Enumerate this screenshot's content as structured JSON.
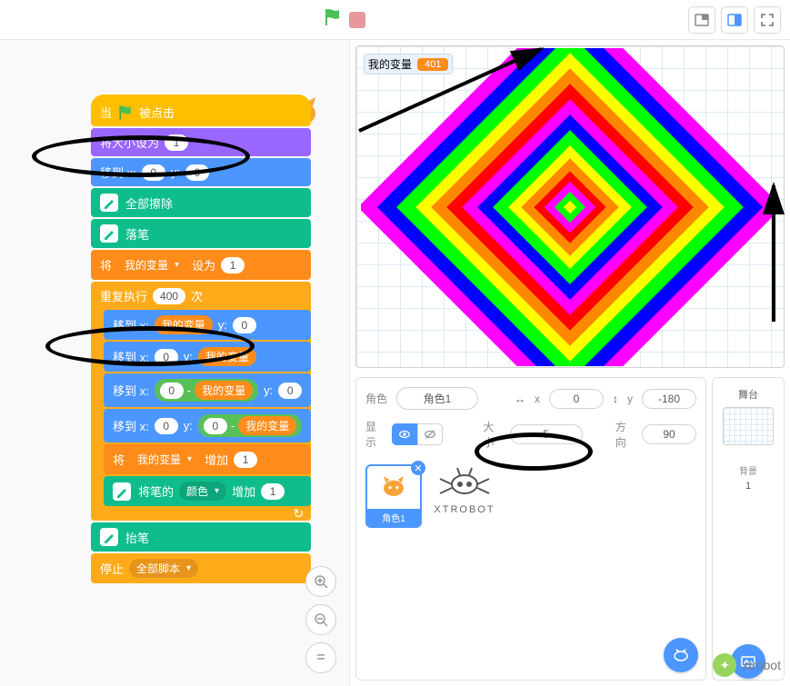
{
  "stage": {
    "variable_label": "我的变量",
    "variable_value": "401"
  },
  "blocks": {
    "when_flag": "当",
    "when_flag_suffix": "被点击",
    "set_size_to": "将大小设为",
    "set_size_val": "1",
    "goto_xy": "移到 x:",
    "y_label": "y:",
    "gx1": "0",
    "gy1": "0",
    "erase_all": "全部擦除",
    "pen_down": "落笔",
    "set_var_prefix": "将",
    "set_var_name": "我的变量",
    "set_var_suffix": "设为",
    "set_var_val": "1",
    "repeat_prefix": "重复执行",
    "repeat_count": "400",
    "repeat_suffix": "次",
    "r1_x_var": "我的变量",
    "r1_y": "0",
    "r2_x": "0",
    "r2_y_var": "我的变量",
    "r3_x": "0",
    "r3_var": "我的变量",
    "r3_y": "0",
    "r4_x": "0",
    "r4_y": "0",
    "r4_var": "我的变量",
    "change_var_prefix": "将",
    "change_var_name": "我的变量",
    "change_var_suffix": "增加",
    "change_var_val": "1",
    "pen_change_prefix": "将笔的",
    "pen_change_color": "颜色",
    "pen_change_suffix": "增加",
    "pen_change_val": "1",
    "pen_up": "抬笔",
    "stop_prefix": "停止",
    "stop_menu": "全部脚本"
  },
  "sprite_info": {
    "name_label": "角色",
    "name_value": "角色1",
    "x_label": "x",
    "x_value": "0",
    "y_label": "y",
    "y_value": "-180",
    "show_label": "显示",
    "size_label": "大小",
    "size_value": "5",
    "direction_label": "方向",
    "direction_value": "90",
    "sprite_thumb_name": "角色1",
    "xtrobot_label": "XTROBOT"
  },
  "stage_panel": {
    "title": "舞台",
    "backdrops_label": "背景",
    "backdrops_count": "1"
  },
  "watermark": "xtrobot",
  "side_buttons": {
    "zoom_in": "+",
    "zoom_out": "−",
    "equals": "="
  },
  "minus": "-"
}
